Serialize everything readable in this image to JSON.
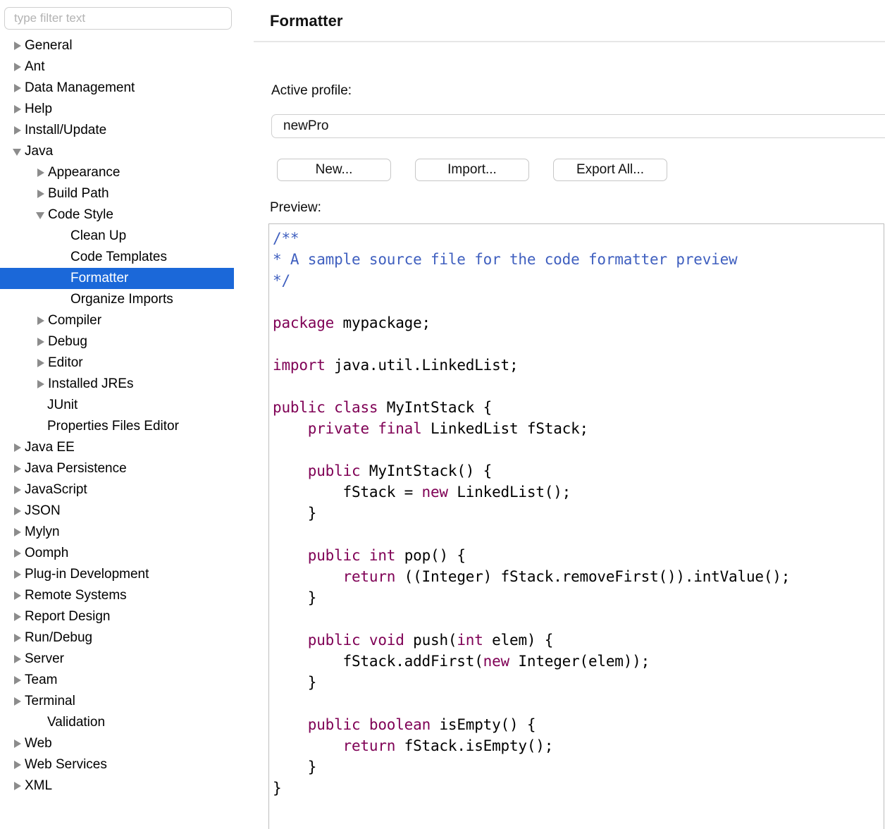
{
  "sidebar": {
    "filter": {
      "placeholder": "type filter text",
      "value": ""
    },
    "items": [
      {
        "label": "General",
        "level": 0,
        "state": "collapsed"
      },
      {
        "label": "Ant",
        "level": 0,
        "state": "collapsed"
      },
      {
        "label": "Data Management",
        "level": 0,
        "state": "collapsed"
      },
      {
        "label": "Help",
        "level": 0,
        "state": "collapsed"
      },
      {
        "label": "Install/Update",
        "level": 0,
        "state": "collapsed"
      },
      {
        "label": "Java",
        "level": 0,
        "state": "expanded"
      },
      {
        "label": "Appearance",
        "level": 1,
        "state": "collapsed"
      },
      {
        "label": "Build Path",
        "level": 1,
        "state": "collapsed"
      },
      {
        "label": "Code Style",
        "level": 1,
        "state": "expanded"
      },
      {
        "label": "Clean Up",
        "level": 2,
        "state": "leaf"
      },
      {
        "label": "Code Templates",
        "level": 2,
        "state": "leaf"
      },
      {
        "label": "Formatter",
        "level": 2,
        "state": "leaf",
        "selected": true
      },
      {
        "label": "Organize Imports",
        "level": 2,
        "state": "leaf"
      },
      {
        "label": "Compiler",
        "level": 1,
        "state": "collapsed"
      },
      {
        "label": "Debug",
        "level": 1,
        "state": "collapsed"
      },
      {
        "label": "Editor",
        "level": 1,
        "state": "collapsed"
      },
      {
        "label": "Installed JREs",
        "level": 1,
        "state": "collapsed"
      },
      {
        "label": "JUnit",
        "level": 1,
        "state": "leaf"
      },
      {
        "label": "Properties Files Editor",
        "level": 1,
        "state": "leaf"
      },
      {
        "label": "Java EE",
        "level": 0,
        "state": "collapsed"
      },
      {
        "label": "Java Persistence",
        "level": 0,
        "state": "collapsed"
      },
      {
        "label": "JavaScript",
        "level": 0,
        "state": "collapsed"
      },
      {
        "label": "JSON",
        "level": 0,
        "state": "collapsed"
      },
      {
        "label": "Mylyn",
        "level": 0,
        "state": "collapsed"
      },
      {
        "label": "Oomph",
        "level": 0,
        "state": "collapsed"
      },
      {
        "label": "Plug-in Development",
        "level": 0,
        "state": "collapsed"
      },
      {
        "label": "Remote Systems",
        "level": 0,
        "state": "collapsed"
      },
      {
        "label": "Report Design",
        "level": 0,
        "state": "collapsed"
      },
      {
        "label": "Run/Debug",
        "level": 0,
        "state": "collapsed"
      },
      {
        "label": "Server",
        "level": 0,
        "state": "collapsed"
      },
      {
        "label": "Team",
        "level": 0,
        "state": "collapsed"
      },
      {
        "label": "Terminal",
        "level": 0,
        "state": "collapsed"
      },
      {
        "label": "Validation",
        "level": 0,
        "state": "leaf"
      },
      {
        "label": "Web",
        "level": 0,
        "state": "collapsed"
      },
      {
        "label": "Web Services",
        "level": 0,
        "state": "collapsed"
      },
      {
        "label": "XML",
        "level": 0,
        "state": "collapsed"
      }
    ]
  },
  "panel": {
    "title": "Formatter",
    "profile_label": "Active profile:",
    "profile_value": "newPro",
    "buttons": [
      {
        "label": "New..."
      },
      {
        "label": "Import..."
      },
      {
        "label": "Export All..."
      }
    ],
    "preview_label": "Preview:",
    "preview_code": [
      {
        "text": "/**",
        "type": "comment"
      },
      {
        "text": "* A sample source file for the code formatter preview",
        "type": "comment"
      },
      {
        "text": "*/",
        "type": "comment"
      },
      {
        "text": "",
        "type": "plain"
      },
      {
        "text": "package mypackage;",
        "type": "code"
      },
      {
        "text": "",
        "type": "plain"
      },
      {
        "text": "import java.util.LinkedList;",
        "type": "code"
      },
      {
        "text": "",
        "type": "plain"
      },
      {
        "text": "public class MyIntStack {",
        "type": "code"
      },
      {
        "text": "    private final LinkedList fStack;",
        "type": "code"
      },
      {
        "text": "",
        "type": "plain"
      },
      {
        "text": "    public MyIntStack() {",
        "type": "code"
      },
      {
        "text": "        fStack = new LinkedList();",
        "type": "code"
      },
      {
        "text": "    }",
        "type": "code"
      },
      {
        "text": "",
        "type": "plain"
      },
      {
        "text": "    public int pop() {",
        "type": "code"
      },
      {
        "text": "        return ((Integer) fStack.removeFirst()).intValue();",
        "type": "code"
      },
      {
        "text": "    }",
        "type": "code"
      },
      {
        "text": "",
        "type": "plain"
      },
      {
        "text": "    public void push(int elem) {",
        "type": "code"
      },
      {
        "text": "        fStack.addFirst(new Integer(elem));",
        "type": "code"
      },
      {
        "text": "    }",
        "type": "code"
      },
      {
        "text": "",
        "type": "plain"
      },
      {
        "text": "    public boolean isEmpty() {",
        "type": "code"
      },
      {
        "text": "        return fStack.isEmpty();",
        "type": "code"
      },
      {
        "text": "    }",
        "type": "code"
      },
      {
        "text": "}",
        "type": "code"
      }
    ],
    "keywords": [
      "package",
      "import",
      "public",
      "class",
      "private",
      "final",
      "new",
      "int",
      "return",
      "void",
      "boolean"
    ]
  },
  "colors": {
    "selection": "#1b68d9",
    "comment": "#3f5fbf",
    "keyword": "#7f0055",
    "border": "#cfcfcf",
    "divider": "#e2e2e2"
  }
}
